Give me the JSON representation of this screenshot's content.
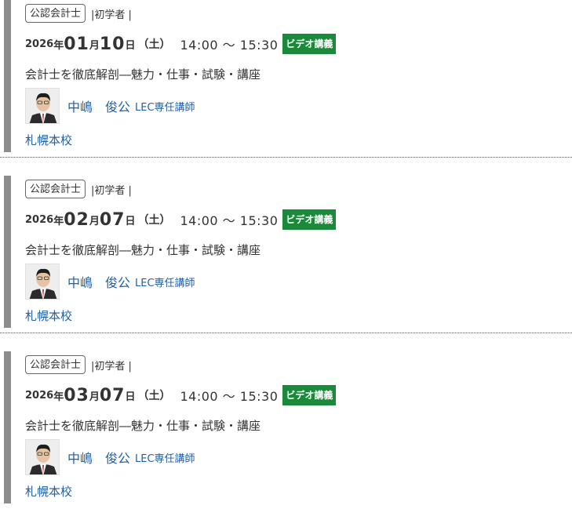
{
  "events": [
    {
      "category": "公認会計士",
      "level": "|初学者 |",
      "year": "2026",
      "year_suffix": "年",
      "month": "01",
      "month_suffix": "月",
      "day": "10",
      "day_suffix": "日",
      "weekday": "（土）",
      "time": "14:00 ～ 15:30",
      "format": "ビデオ講義",
      "title": "会計士を徹底解剖―魅力・仕事・試験・講座",
      "lecturer_name": "中嶋　俊公",
      "lecturer_role": "LEC専任講師",
      "school": "札幌本校"
    },
    {
      "category": "公認会計士",
      "level": "|初学者 |",
      "year": "2026",
      "year_suffix": "年",
      "month": "02",
      "month_suffix": "月",
      "day": "07",
      "day_suffix": "日",
      "weekday": "（土）",
      "time": "14:00 ～ 15:30",
      "format": "ビデオ講義",
      "title": "会計士を徹底解剖―魅力・仕事・試験・講座",
      "lecturer_name": "中嶋　俊公",
      "lecturer_role": "LEC専任講師",
      "school": "札幌本校"
    },
    {
      "category": "公認会計士",
      "level": "|初学者 |",
      "year": "2026",
      "year_suffix": "年",
      "month": "03",
      "month_suffix": "月",
      "day": "07",
      "day_suffix": "日",
      "weekday": "（土）",
      "time": "14:00 ～ 15:30",
      "format": "ビデオ講義",
      "title": "会計士を徹底解剖―魅力・仕事・試験・講座",
      "lecturer_name": "中嶋　俊公",
      "lecturer_role": "LEC専任講師",
      "school": "札幌本校"
    }
  ],
  "colors": {
    "accent_bar": "#8c8c8c",
    "video_badge": "#1a8a3a",
    "link": "#1f5fa8"
  }
}
